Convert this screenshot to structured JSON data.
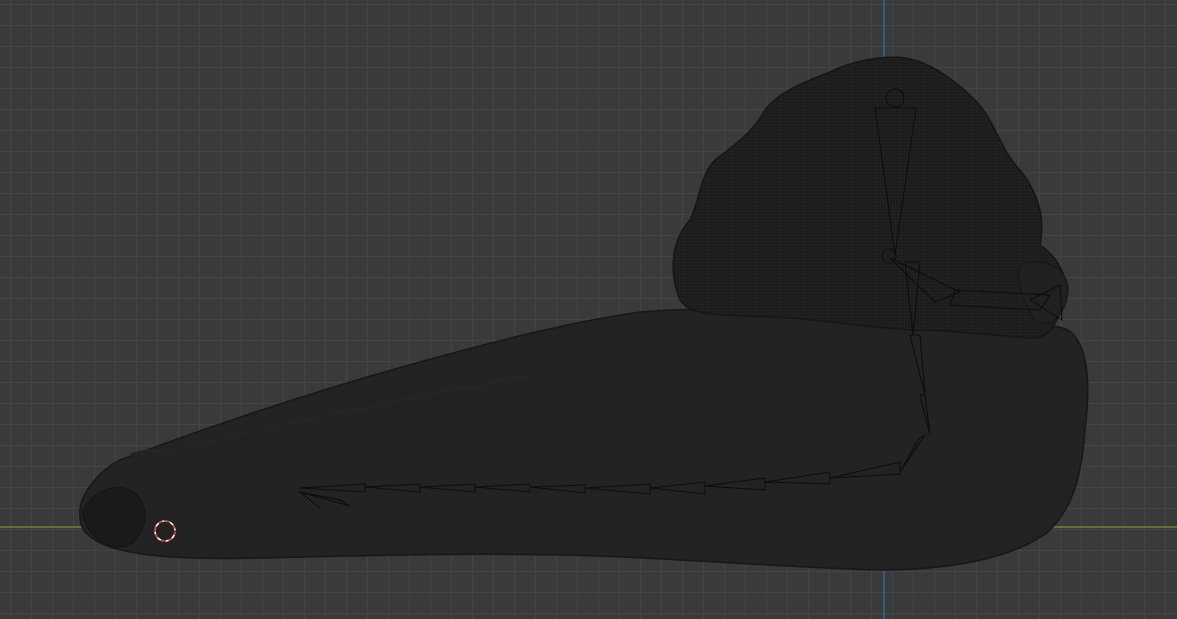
{
  "viewport": {
    "view": "3d-viewport-orthographic",
    "axis_x_color": "#6b9a2e",
    "axis_z_color": "#2f6fb0",
    "grid_color": "#464646",
    "background_color": "#3a3a3a",
    "mesh_color": "#1c1c1c",
    "cursor_color_primary": "#d83a2e",
    "cursor_color_secondary": "#ffffff"
  },
  "objects": {
    "mesh": {
      "icon": "creature-mesh",
      "display": "wireframe-overlay"
    },
    "armature": {
      "icon": "armature-bones",
      "display": "octahedral"
    },
    "cursor": {
      "icon": "3d-cursor"
    }
  }
}
